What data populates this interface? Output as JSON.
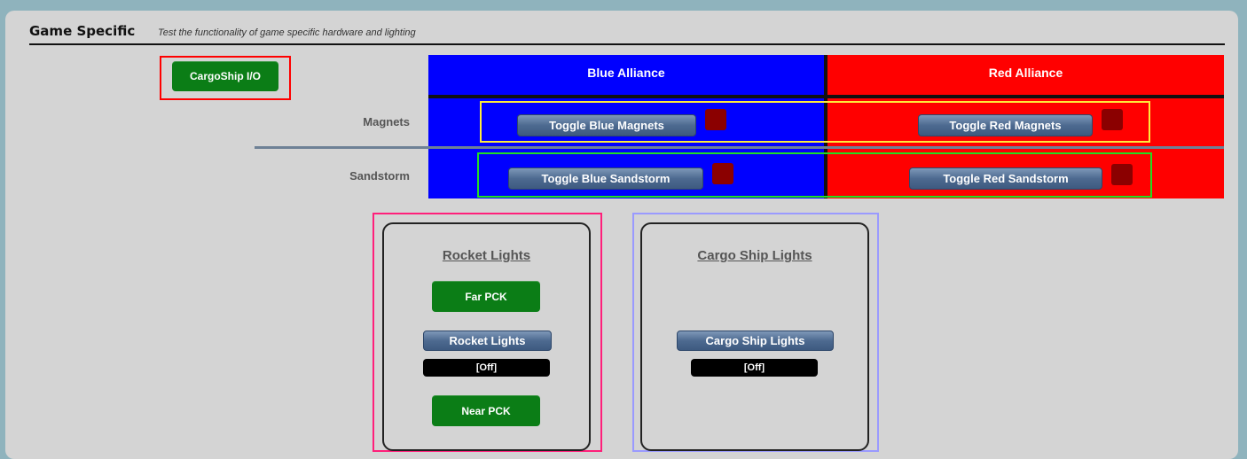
{
  "header": {
    "title": "Game Specific",
    "subtitle": "Test the functionality of game specific hardware and lighting"
  },
  "cargoship_io": {
    "label": "CargoShip I/O"
  },
  "alliances": {
    "blue": {
      "title": "Blue Alliance",
      "color": "#0000ff"
    },
    "red": {
      "title": "Red Alliance",
      "color": "#ff0000"
    }
  },
  "rows": {
    "magnets": {
      "label": "Magnets",
      "blue_button": "Toggle Blue Magnets",
      "red_button": "Toggle Red Magnets"
    },
    "sandstorm": {
      "label": "Sandstorm",
      "blue_button": "Toggle Blue Sandstorm",
      "red_button": "Toggle Red Sandstorm"
    }
  },
  "rocket_lights": {
    "title": "Rocket Lights",
    "far_button": "Far PCK",
    "toggle_button": "Rocket Lights",
    "status": "[Off]",
    "near_button": "Near PCK"
  },
  "cargo_ship_lights": {
    "title": "Cargo Ship Lights",
    "toggle_button": "Cargo Ship Lights",
    "status": "[Off]"
  },
  "colors": {
    "indicator_off": "#8b0000",
    "green_button": "#0b7d16",
    "highlight_red": "#ff0000",
    "highlight_yellow": "#ffeb3b",
    "highlight_green": "#22dd22",
    "highlight_pink": "#ff1f7a",
    "highlight_lavender": "#9a9aff"
  }
}
